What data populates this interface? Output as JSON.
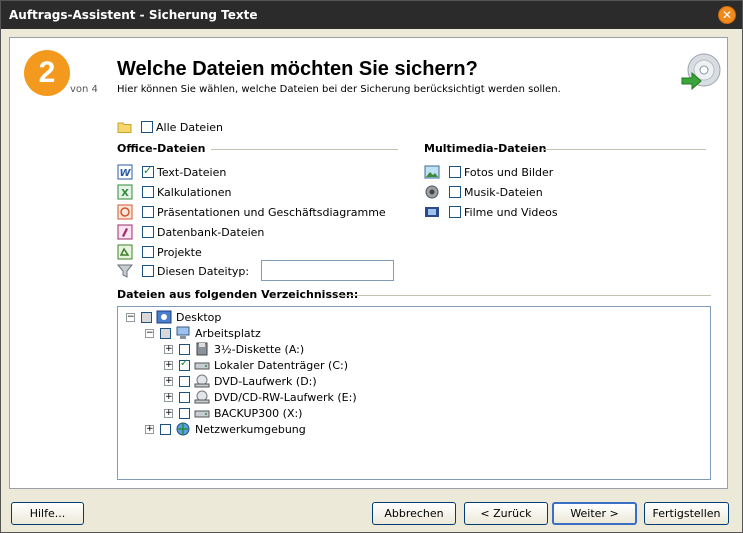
{
  "window": {
    "title": "Auftrags-Assistent - Sicherung Texte",
    "close_icon": "close-icon"
  },
  "header": {
    "step_number": "2",
    "step_of": "von 4",
    "title": "Welche Dateien möchten Sie sichern?",
    "subtitle": "Hier können Sie wählen, welche Dateien bei der Sicherung berücksichtigt werden sollen."
  },
  "all_files": {
    "label": "Alle Dateien",
    "checked": false
  },
  "office": {
    "heading": "Office-Dateien",
    "items": [
      {
        "label": "Text-Dateien",
        "checked": true,
        "icon": "word-icon"
      },
      {
        "label": "Kalkulationen",
        "checked": false,
        "icon": "excel-icon"
      },
      {
        "label": "Präsentationen und Geschäftsdiagramme",
        "checked": false,
        "icon": "powerpoint-icon"
      },
      {
        "label": "Datenbank-Dateien",
        "checked": false,
        "icon": "access-icon"
      },
      {
        "label": "Projekte",
        "checked": false,
        "icon": "project-icon"
      },
      {
        "label": "Diesen Dateityp:",
        "checked": false,
        "icon": "filter-icon"
      }
    ],
    "filetype_value": ""
  },
  "multimedia": {
    "heading": "Multimedia-Dateien",
    "items": [
      {
        "label": "Fotos und Bilder",
        "checked": false,
        "icon": "picture-icon"
      },
      {
        "label": "Musik-Dateien",
        "checked": false,
        "icon": "speaker-icon"
      },
      {
        "label": "Filme und Videos",
        "checked": false,
        "icon": "film-icon"
      }
    ]
  },
  "folders": {
    "heading": "Dateien aus folgenden Verzeichnissen:",
    "tree": [
      {
        "label": "Desktop",
        "expander": "−",
        "state": "partial",
        "icon": "desktop-icon"
      },
      {
        "label": "Arbeitsplatz",
        "expander": "−",
        "state": "partial",
        "icon": "computer-icon"
      },
      {
        "label": "3½-Diskette (A:)",
        "expander": "+",
        "state": "unchecked",
        "icon": "floppy-icon"
      },
      {
        "label": "Lokaler Datenträger (C:)",
        "expander": "+",
        "state": "checked",
        "icon": "harddisk-icon"
      },
      {
        "label": "DVD-Laufwerk (D:)",
        "expander": "+",
        "state": "unchecked",
        "icon": "dvd-icon"
      },
      {
        "label": "DVD/CD-RW-Laufwerk (E:)",
        "expander": "+",
        "state": "unchecked",
        "icon": "cdrw-icon"
      },
      {
        "label": "BACKUP300 (X:)",
        "expander": "+",
        "state": "unchecked",
        "icon": "harddisk-icon"
      },
      {
        "label": "Netzwerkumgebung",
        "expander": "+",
        "state": "unchecked",
        "icon": "network-icon"
      }
    ]
  },
  "buttons": {
    "help": "Hilfe...",
    "cancel": "Abbrechen",
    "back": "< Zurück",
    "next": "Weiter >",
    "finish": "Fertigstellen"
  },
  "colors": {
    "accent": "#f39a1e",
    "titlebar": "#2b2b2b",
    "check": "#1a8a1a"
  }
}
